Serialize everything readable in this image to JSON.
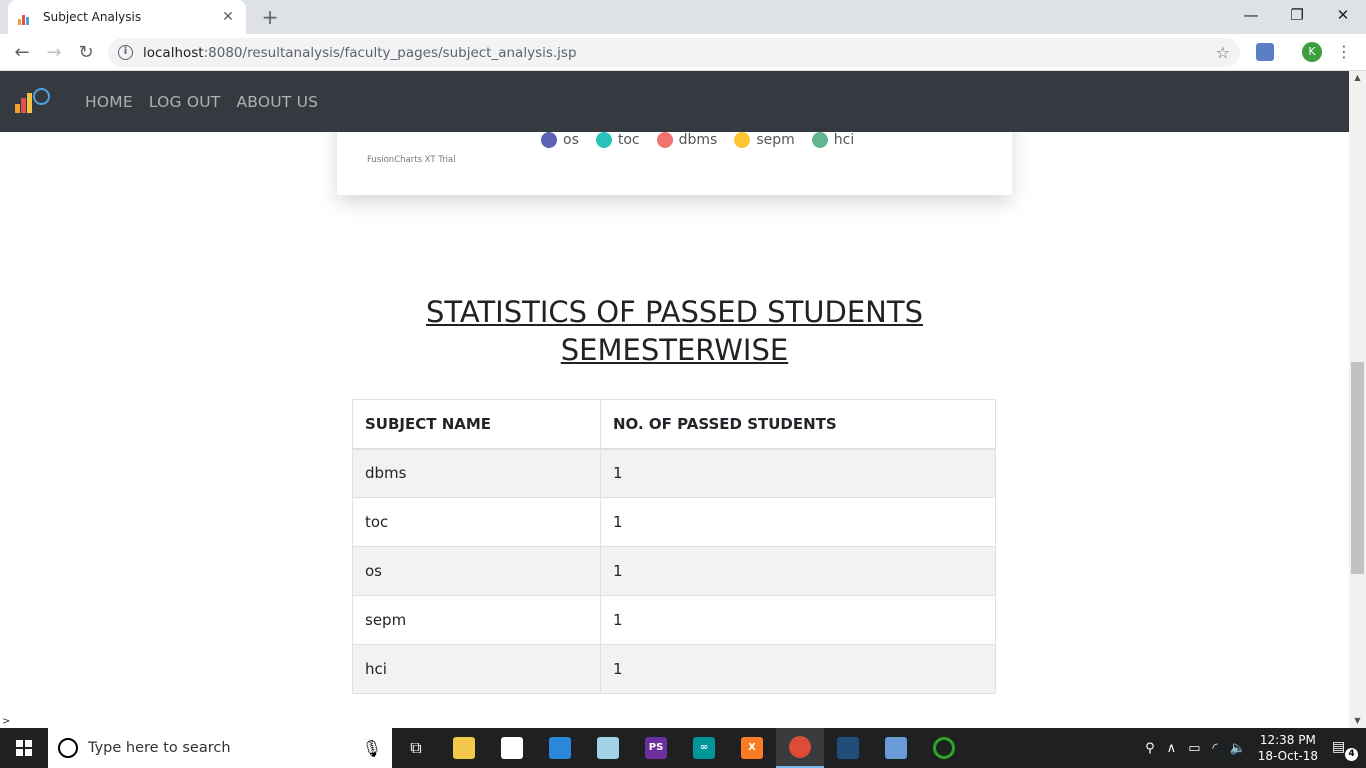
{
  "browser": {
    "tab_title": "Subject Analysis",
    "tab_close": "✕",
    "new_tab": "+",
    "url_host": "localhost",
    "url_rest": ":8080/resultanalysis/faculty_pages/subject_analysis.jsp",
    "profile_initial": "K",
    "window_controls": {
      "minimize": "—",
      "restore": "❐",
      "close": "✕"
    }
  },
  "nav": {
    "items": [
      "HOME",
      "LOG OUT",
      "ABOUT US"
    ]
  },
  "chart": {
    "legend": [
      {
        "label": "os",
        "color": "#5d62b5"
      },
      {
        "label": "toc",
        "color": "#29c3be"
      },
      {
        "label": "dbms",
        "color": "#f2726f"
      },
      {
        "label": "sepm",
        "color": "#ffc533"
      },
      {
        "label": "hci",
        "color": "#62b58f"
      }
    ],
    "trial_text": "FusionCharts XT Trial"
  },
  "section": {
    "title_line1": "STATISTICS OF PASSED STUDENTS",
    "title_line2": "SEMESTERWISE"
  },
  "table": {
    "headers": [
      "SUBJECT NAME",
      "NO. OF PASSED STUDENTS"
    ],
    "rows": [
      [
        "dbms",
        "1"
      ],
      [
        "toc",
        "1"
      ],
      [
        "os",
        "1"
      ],
      [
        "sepm",
        "1"
      ],
      [
        "hci",
        "1"
      ]
    ]
  },
  "taskbar": {
    "search_placeholder": "Type here to search",
    "time": "12:38 PM",
    "date": "18-Oct-18",
    "notification_count": "4",
    "apps": [
      {
        "name": "task-view-icon",
        "glyph": "⧉",
        "color": "transparent"
      },
      {
        "name": "file-explorer-icon",
        "glyph": "",
        "color": "#f3c94a"
      },
      {
        "name": "store-icon",
        "glyph": "",
        "color": "#ffffff"
      },
      {
        "name": "remote-desktop-icon",
        "glyph": "",
        "color": "#2b88d8"
      },
      {
        "name": "notepad-icon",
        "glyph": "",
        "color": "#9fd3e8"
      },
      {
        "name": "phpstorm-icon",
        "glyph": "PS",
        "color": "#6b2fa0"
      },
      {
        "name": "arduino-icon",
        "glyph": "∞",
        "color": "#00979c"
      },
      {
        "name": "xampp-icon",
        "glyph": "X",
        "color": "#fb7a24"
      },
      {
        "name": "chrome-icon",
        "glyph": "",
        "color": "#dd4b39"
      },
      {
        "name": "mysql-workbench-icon",
        "glyph": "",
        "color": "#1d4f7a"
      },
      {
        "name": "virtualbox-icon",
        "glyph": "",
        "color": "#6a9ad8"
      },
      {
        "name": "torrent-icon",
        "glyph": "",
        "color": "#2aa52a"
      }
    ]
  }
}
